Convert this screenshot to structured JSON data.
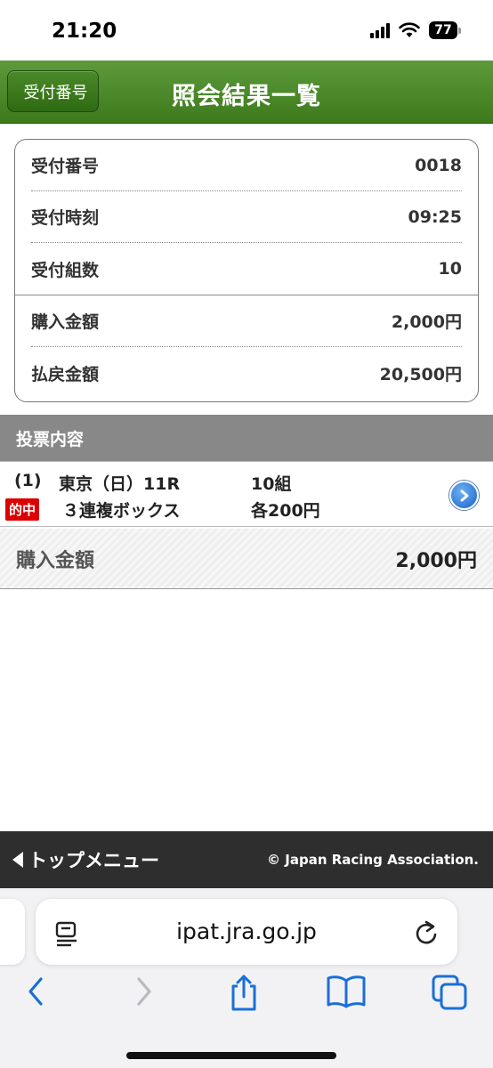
{
  "status_bar": {
    "time": "21:20",
    "battery": "77"
  },
  "nav": {
    "back_label": "受付番号",
    "title": "照会結果一覧"
  },
  "receipt": {
    "rows": [
      {
        "label": "受付番号",
        "value": "0018"
      },
      {
        "label": "受付時刻",
        "value": "09:25"
      },
      {
        "label": "受付組数",
        "value": "10"
      },
      {
        "label": "購入金額",
        "value": "2,000円"
      },
      {
        "label": "払戻金額",
        "value": "20,500円"
      }
    ]
  },
  "bet_section": {
    "header": "投票内容",
    "bet": {
      "index": "(1)",
      "race": "東京（日）11R",
      "combos": "10組",
      "hit_badge": "的中",
      "bet_type": "３連複ボックス",
      "unit": "各200円"
    },
    "total_label": "購入金額",
    "total_value": "2,000円"
  },
  "footer": {
    "menu_label": "トップメニュー",
    "copyright": "© Japan Racing Association."
  },
  "browser": {
    "url": "ipat.jra.go.jp"
  },
  "colors": {
    "header_green": "#3c7a1c",
    "hit_red": "#dd0000",
    "section_gray": "#888888",
    "footer_dark": "#2e2e2e",
    "ios_blue": "#1a6fd8"
  }
}
